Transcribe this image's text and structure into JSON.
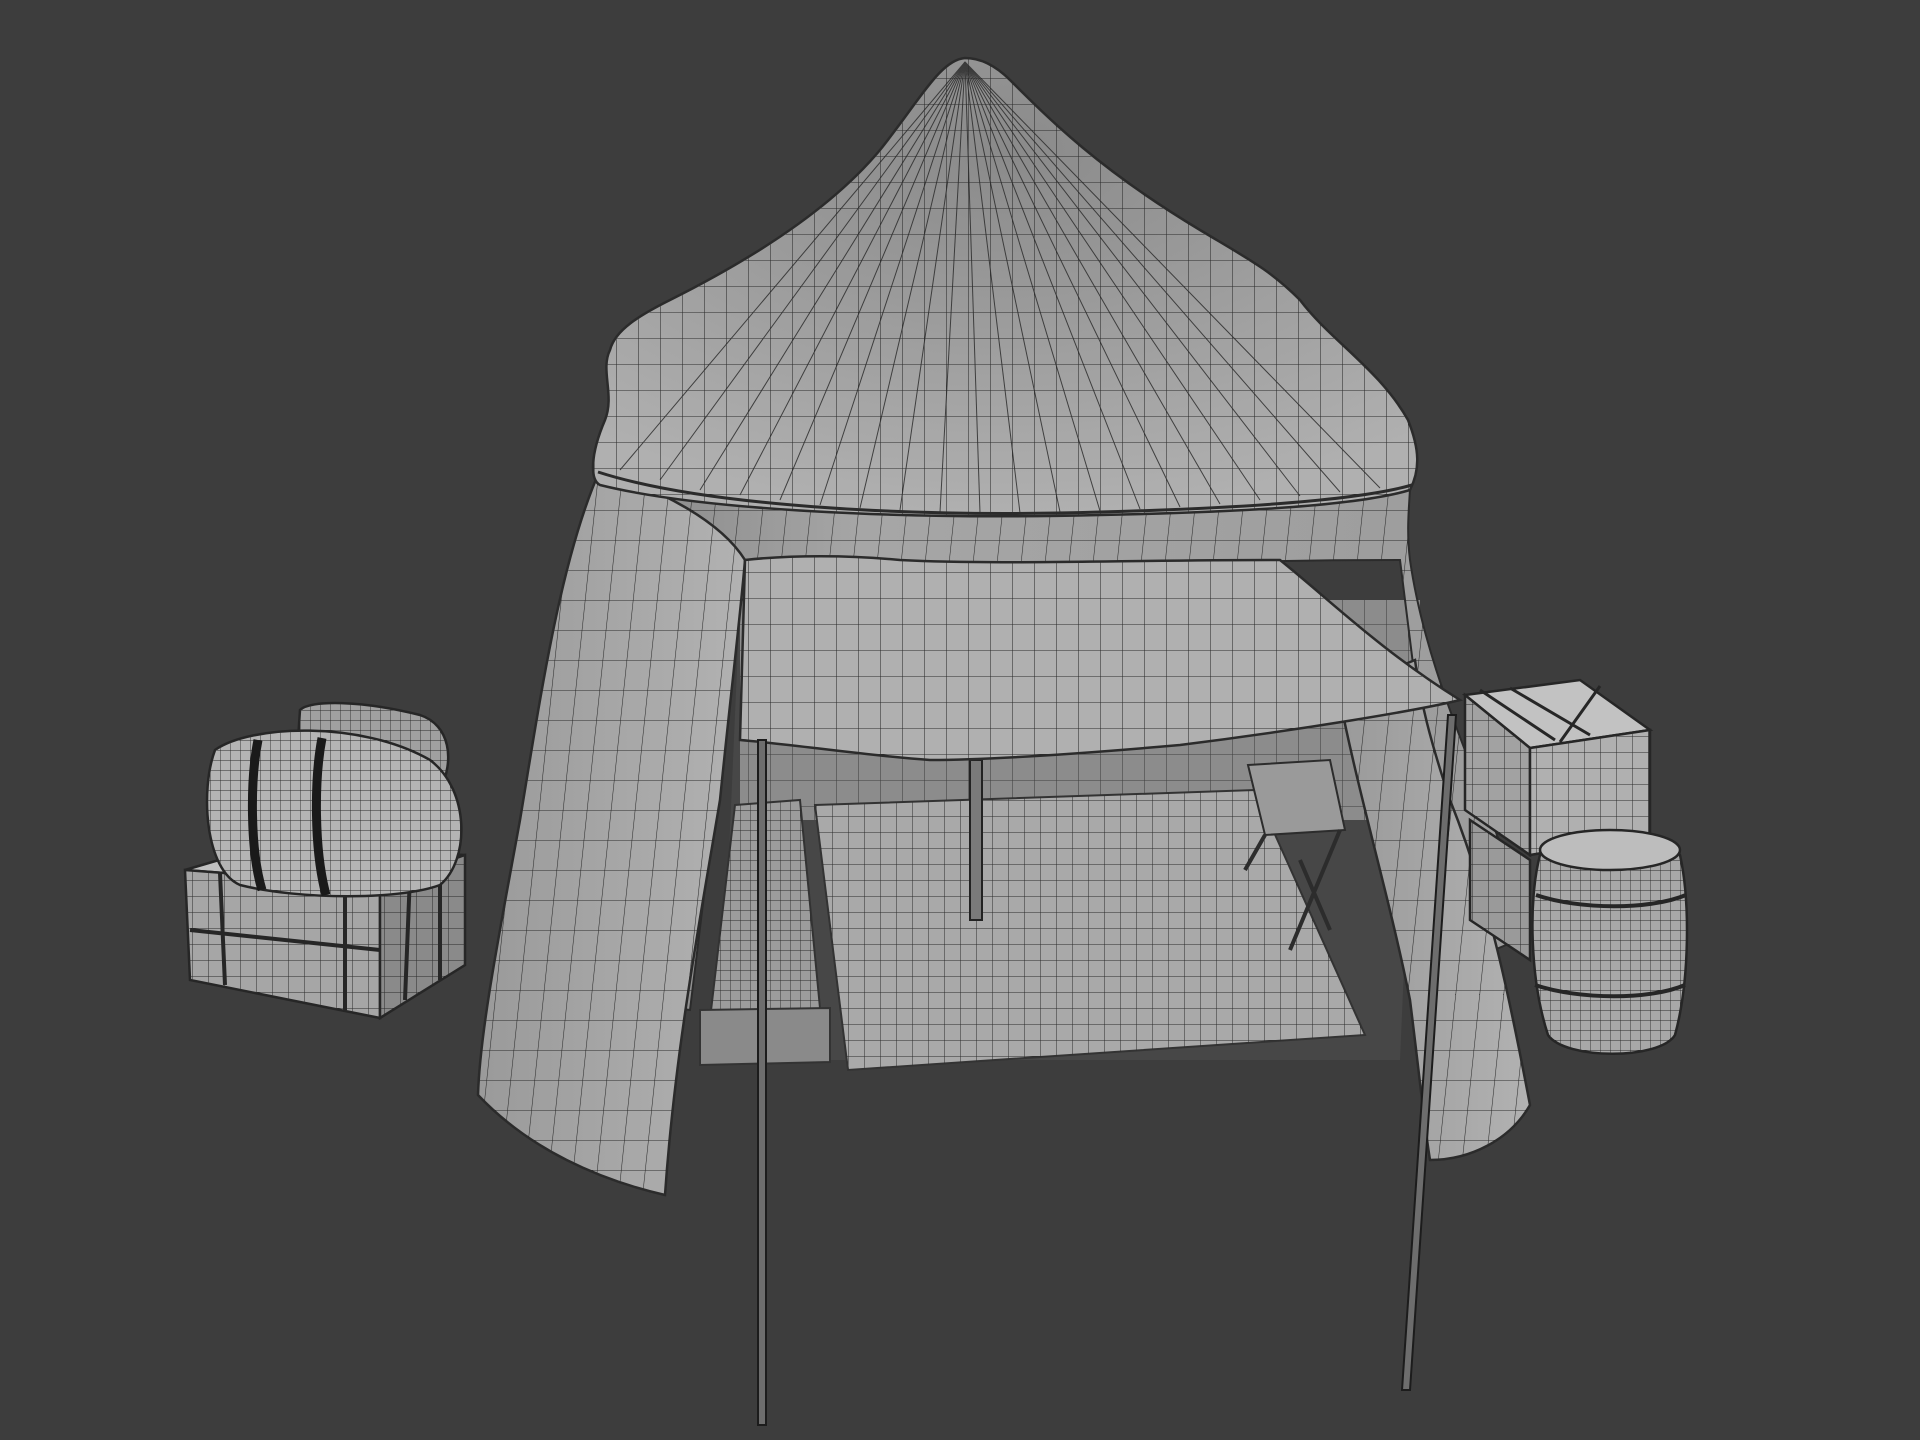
{
  "scene": {
    "subject": "tent-wireframe-render",
    "colors": {
      "background": "#3d3d3d",
      "surface": "#9a9a9a",
      "surface_light": "#b4b4b4",
      "surface_dark": "#6e6e6e",
      "wire": "#2a2a2a",
      "pole": "#1e1e1e"
    },
    "objects": [
      "tent-roof",
      "tent-wall",
      "tent-awning",
      "tent-flap-left",
      "tent-flap-right",
      "front-pole-left",
      "front-pole-right",
      "center-pole",
      "ground-rug",
      "bedroll",
      "side-table",
      "left-crate",
      "wrapped-bundle",
      "right-crate-stack",
      "barrel"
    ]
  }
}
